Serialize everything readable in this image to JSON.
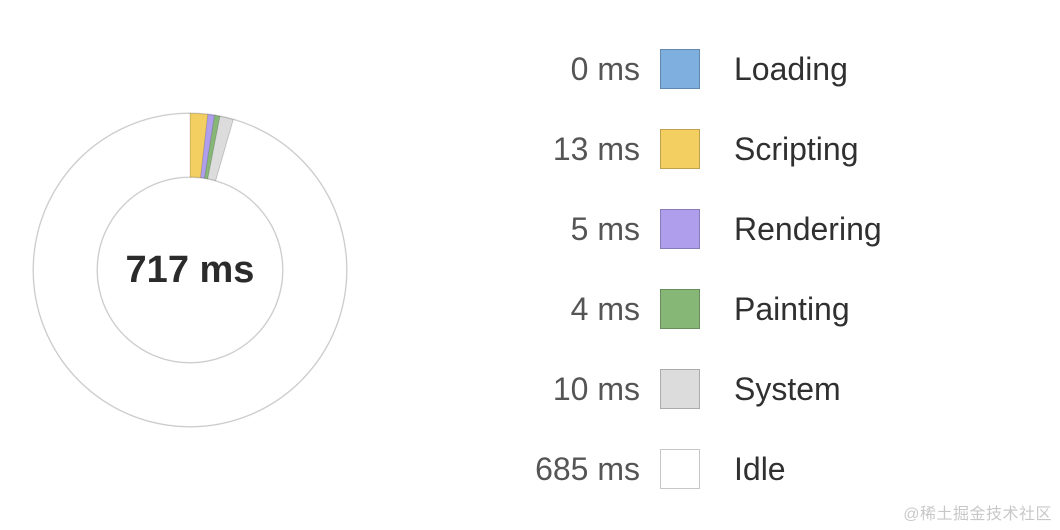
{
  "chart_data": {
    "type": "pie",
    "title": "",
    "total_label": "717 ms",
    "unit": "ms",
    "series": [
      {
        "name": "Loading",
        "value": 0,
        "color": "#7FAFDE"
      },
      {
        "name": "Scripting",
        "value": 13,
        "color": "#F3CF62"
      },
      {
        "name": "Rendering",
        "value": 5,
        "color": "#AF9EEB"
      },
      {
        "name": "Painting",
        "value": 4,
        "color": "#86B777"
      },
      {
        "name": "System",
        "value": 10,
        "color": "#DCDCDC"
      },
      {
        "name": "Idle",
        "value": 685,
        "color": "#FFFFFF"
      }
    ]
  },
  "legend": {
    "unit": "ms",
    "items": [
      {
        "time": "0 ms",
        "label": "Loading",
        "color": "#7FAFDE"
      },
      {
        "time": "13 ms",
        "label": "Scripting",
        "color": "#F3CF62"
      },
      {
        "time": "5 ms",
        "label": "Rendering",
        "color": "#AF9EEB"
      },
      {
        "time": "4 ms",
        "label": "Painting",
        "color": "#86B777"
      },
      {
        "time": "10 ms",
        "label": "System",
        "color": "#DCDCDC"
      },
      {
        "time": "685 ms",
        "label": "Idle",
        "color": "#FFFFFF"
      }
    ]
  },
  "watermark": "@稀土掘金技术社区"
}
